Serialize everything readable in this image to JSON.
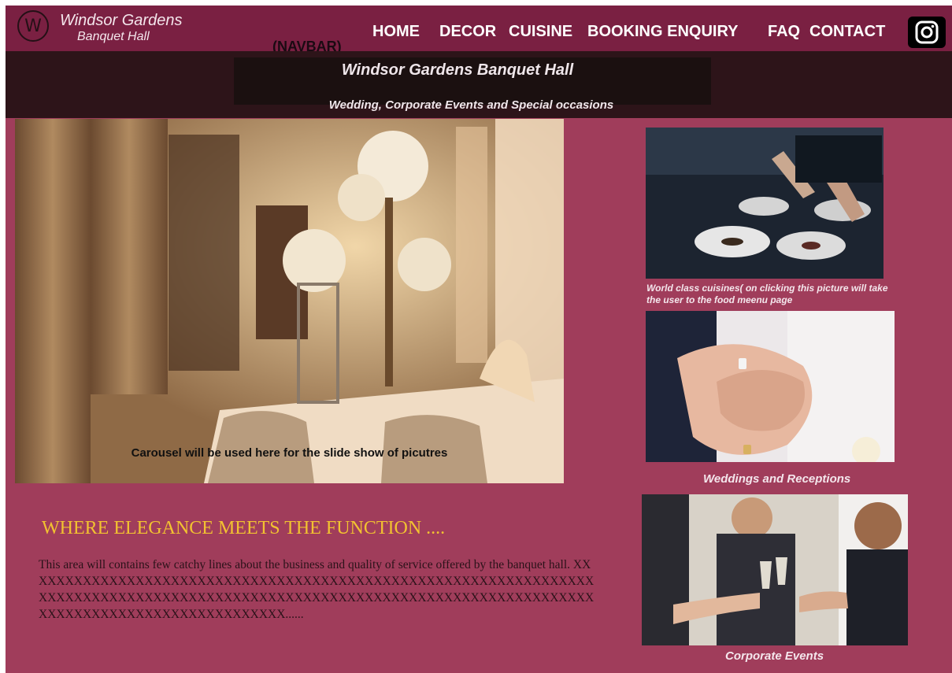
{
  "navbar": {
    "logo_letter": "W",
    "brand_line1": "Windsor Gardens",
    "brand_line2": "Banquet Hall",
    "note": "(NAVBAR)",
    "links": [
      {
        "label": "HOME"
      },
      {
        "label": "DECOR"
      },
      {
        "label": "CUISINE"
      },
      {
        "label": "BOOKING ENQUIRY"
      },
      {
        "label": "FAQ"
      },
      {
        "label": "CONTACT"
      }
    ],
    "social_icon": "instagram-icon"
  },
  "header": {
    "title": "Windsor Gardens Banquet Hall",
    "subtitle": "Wedding, Corporate Events and Special occasions"
  },
  "carousel": {
    "caption": "Carousel will be used here for the slide show of picutres"
  },
  "main": {
    "tagline": "WHERE ELEGANCE MEETS THE FUNCTION ....",
    "intro": "This area will contains few catchy lines about the business and quality of service offered by the banquet hall. XXXXXXXXXXXXXXXXXXXXXXXXXXXXXXXXXXXXXXXXXXXXXXXXXXXXXXXXXXXXXXXXXXXXXXXXXXXXXXXXXXXXXXXXXXXXXXXXXXXXXXXXXXXXXXXXXXXXXXXXXXXXXXXXXXXXXXXXXXXXXXXXXXXXXXXXXXXX......"
  },
  "cards": {
    "cuisine_caption": "World class cuisines( on clicking this picture will take the user to the food meenu page",
    "weddings_caption": "Weddings and Receptions",
    "corporate_caption": "Corporate Events"
  },
  "colors": {
    "navbar": "#7a2042",
    "page": "#a03d5b",
    "header_band": "#2d1419",
    "tagline": "#f2c230"
  }
}
